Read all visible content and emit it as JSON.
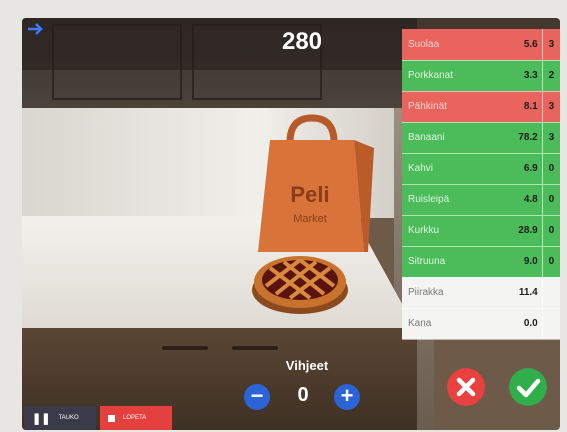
{
  "score": "280",
  "items": [
    {
      "name": "Suolaa",
      "value": "5.6",
      "count": "3",
      "status": "red"
    },
    {
      "name": "Porkkanat",
      "value": "3.3",
      "count": "2",
      "status": "green"
    },
    {
      "name": "Pähkinät",
      "value": "8.1",
      "count": "3",
      "status": "red"
    },
    {
      "name": "Banaani",
      "value": "78.2",
      "count": "3",
      "status": "green"
    },
    {
      "name": "Kahvi",
      "value": "6.9",
      "count": "0",
      "status": "green"
    },
    {
      "name": "Ruisleipä",
      "value": "4.8",
      "count": "0",
      "status": "green"
    },
    {
      "name": "Kurkku",
      "value": "28.9",
      "count": "0",
      "status": "green"
    },
    {
      "name": "Sitruuna",
      "value": "9.0",
      "count": "0",
      "status": "green"
    },
    {
      "name": "Piirakka",
      "value": "11.4",
      "count": "",
      "status": "white"
    },
    {
      "name": "Kana",
      "value": "0.0",
      "count": "",
      "status": "white"
    }
  ],
  "bag": {
    "line1": "Peli",
    "line2": "Market"
  },
  "hints": {
    "label": "Vihjeet",
    "count": "0",
    "minus": "−",
    "plus": "+"
  },
  "controls": {
    "pause_label": "TAUKO",
    "stop_label": "LOPETA"
  },
  "colors": {
    "accent_blue": "#2c63d6",
    "wrong_red": "#e8413f",
    "correct_green": "#2fae4a"
  }
}
